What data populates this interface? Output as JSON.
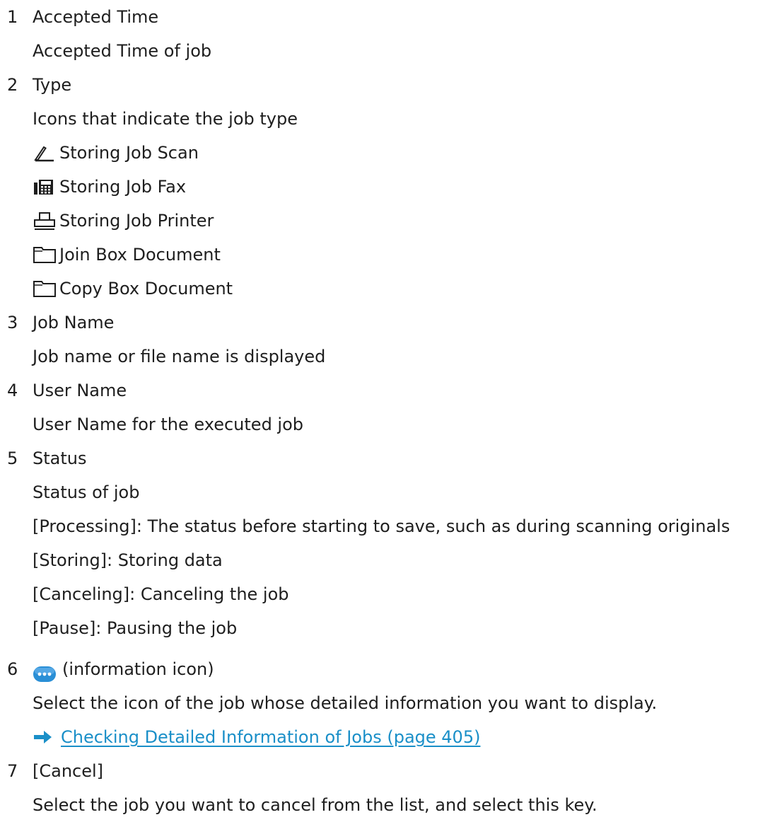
{
  "items": [
    {
      "num": "1",
      "title": "Accepted Time",
      "desc": "Accepted Time of job"
    },
    {
      "num": "2",
      "title": "Type",
      "desc": "Icons that indicate the job type",
      "types": [
        {
          "label": "Storing Job Scan",
          "icon": "scan-icon"
        },
        {
          "label": "Storing Job Fax",
          "icon": "fax-icon"
        },
        {
          "label": "Storing Job Printer",
          "icon": "printer-icon"
        },
        {
          "label": "Join Box Document",
          "icon": "folder-icon"
        },
        {
          "label": "Copy Box Document",
          "icon": "folder-icon"
        }
      ]
    },
    {
      "num": "3",
      "title": "Job Name",
      "desc": "Job name or file name is displayed"
    },
    {
      "num": "4",
      "title": "User Name",
      "desc": "User Name for the executed job"
    },
    {
      "num": "5",
      "title": "Status",
      "desc": "Status of job",
      "statuses": [
        "[Processing]: The status before starting to save, such as during scanning originals",
        "[Storing]: Storing data",
        "[Canceling]: Canceling the job",
        "[Pause]: Pausing the job"
      ]
    },
    {
      "num": "6",
      "title": "(information icon)",
      "icon": "information-icon",
      "desc": "Select the icon of the job whose detailed information you want to display.",
      "link": "Checking Detailed Information of Jobs (page 405)"
    },
    {
      "num": "7",
      "title": "[Cancel]",
      "desc": "Select the job you want to cancel from the list, and select this key."
    }
  ],
  "colors": {
    "text": "#1e1e1e",
    "link": "#1a8fc8",
    "info_icon": "#2a8fd6"
  }
}
